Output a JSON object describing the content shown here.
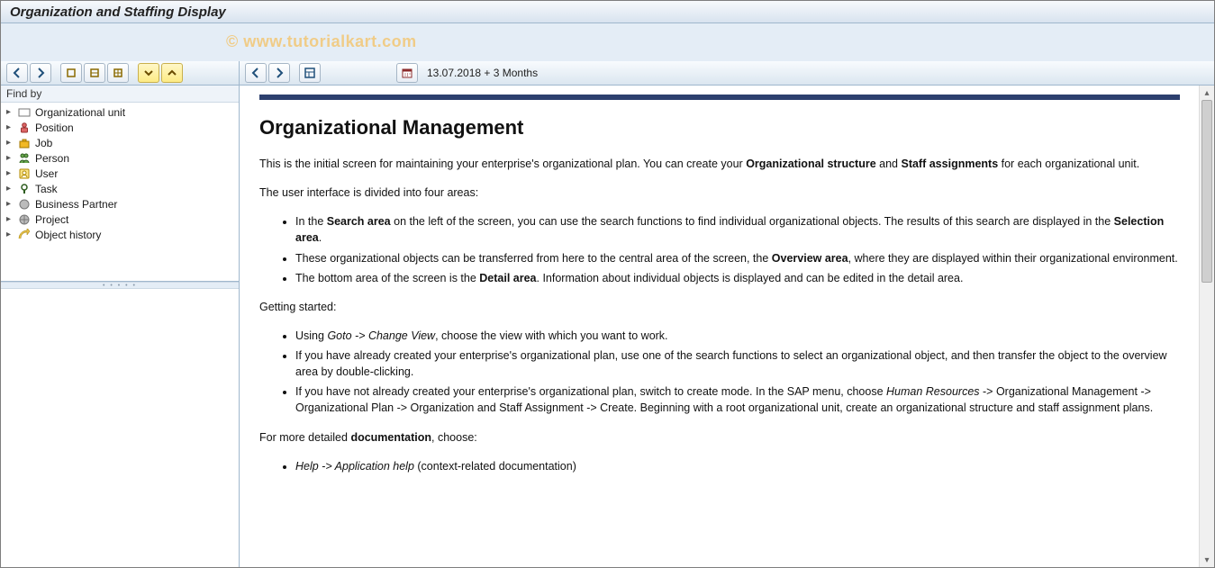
{
  "window": {
    "title": "Organization and Staffing Display"
  },
  "watermark": "© www.tutorialkart.com",
  "left_toolbar": {
    "back_tip": "Back",
    "forward_tip": "Forward",
    "btn3_tip": "Tool 3",
    "btn4_tip": "Tool 4",
    "btn5_tip": "Tool 5",
    "btn6_tip": "Tool 6",
    "btn7_tip": "Tool 7"
  },
  "sidebar": {
    "header": "Find by",
    "items": [
      {
        "label": "Organizational unit",
        "icon": "org-unit"
      },
      {
        "label": "Position",
        "icon": "position"
      },
      {
        "label": "Job",
        "icon": "job"
      },
      {
        "label": "Person",
        "icon": "person"
      },
      {
        "label": "User",
        "icon": "user"
      },
      {
        "label": "Task",
        "icon": "task"
      },
      {
        "label": "Business Partner",
        "icon": "partner"
      },
      {
        "label": "Project",
        "icon": "project"
      },
      {
        "label": "Object history",
        "icon": "history"
      }
    ]
  },
  "right_toolbar": {
    "date_text": "13.07.2018  + 3 Months",
    "back_tip": "Back",
    "forward_tip": "Forward",
    "layout_tip": "Layout",
    "calendar_tip": "Select date"
  },
  "content": {
    "title": "Organizational Management",
    "intro_html": "This is the initial screen for maintaining your enterprise's organizational plan. You can create your <b>Organizational structure</b> and <b>Staff assignments</b> for each organizational unit.",
    "p2": "The user interface is divided into four areas:",
    "areas": [
      "In the <b>Search area</b> on the left of the screen, you can use the search functions to find individual organizational objects. The results of this search are displayed in the <b>Selection area</b>.",
      "These organizational objects can be transferred from here to the central area of the screen, the <b>Overview area</b>, where they are displayed within their organizational environment.",
      "The bottom area of the screen is the <b>Detail area</b>. Information about individual objects is displayed and can be edited in the detail area."
    ],
    "getting_started_label": "Getting started:",
    "getting_started": [
      "Using <i>Goto -> Change View</i>, choose the view with which you want to work.",
      "If you have already created your enterprise's organizational plan, use one of the search functions to select an organizational object, and then transfer the object to the overview area by double-clicking.",
      "If you have not already created your enterprise's organizational plan, switch to create mode. In the SAP menu, choose <i>Human Resources</i> -> Organizational Management -> Organizational Plan -> Organization and Staff Assignment -> Create. Beginning with a root organizational unit, create an organizational structure and staff assignment plans."
    ],
    "doc_label_html": "For more detailed <b>documentation</b>, choose:",
    "doc": [
      "<i>Help -> Application help</i> (context-related documentation)"
    ]
  }
}
